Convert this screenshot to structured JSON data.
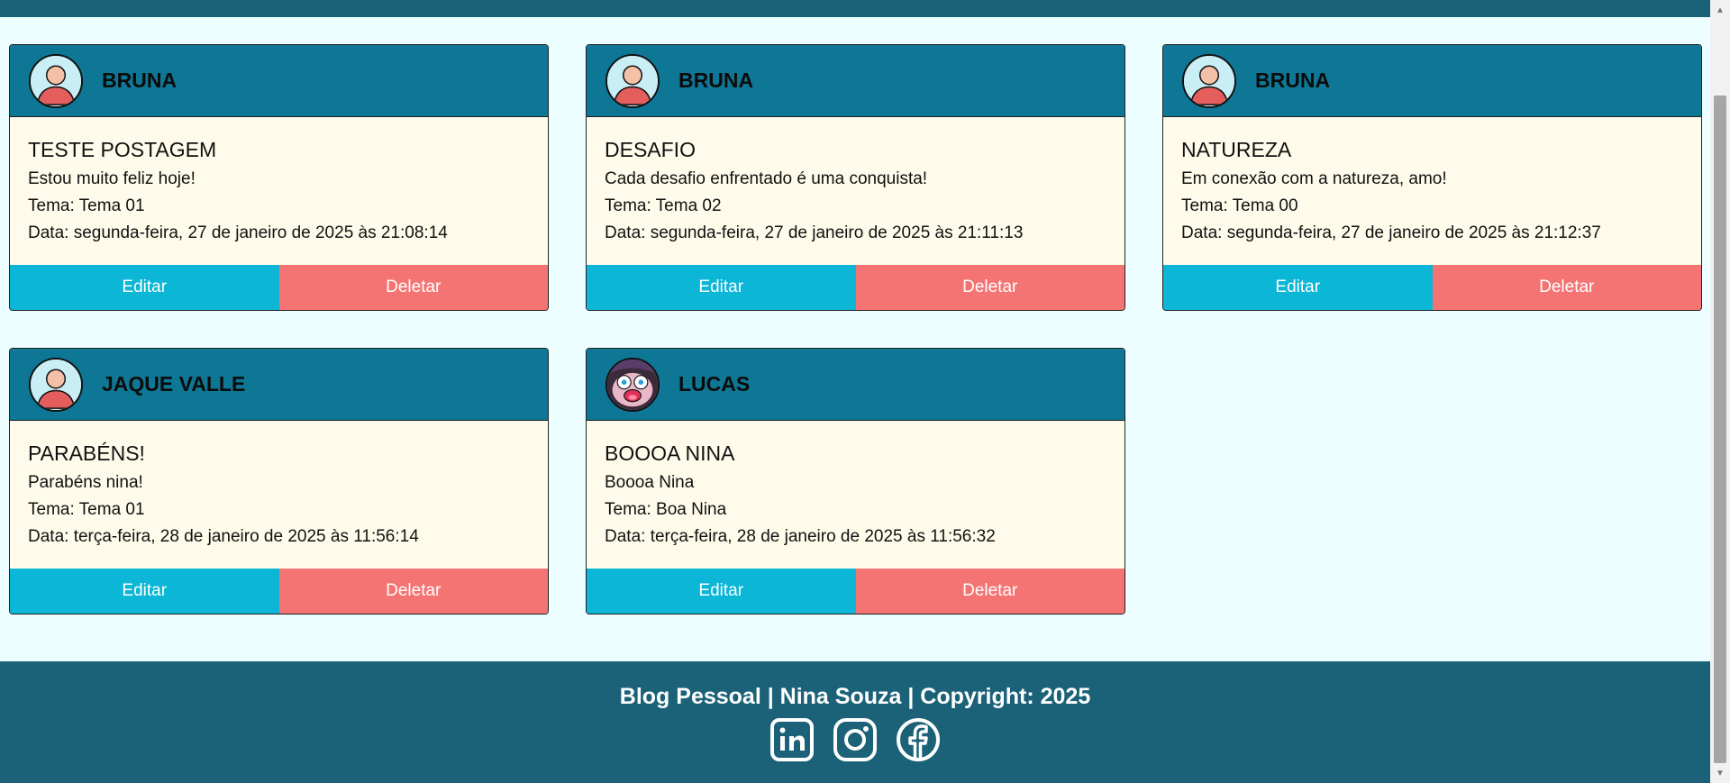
{
  "posts": [
    {
      "author": "BRUNA",
      "avatar": "default-user-avatar",
      "title": "TESTE POSTAGEM",
      "text": "Estou muito feliz hoje!",
      "theme": "Tema: Tema 01",
      "date": "Data: segunda-feira, 27 de janeiro de 2025 às 21:08:14",
      "edit_label": "Editar",
      "delete_label": "Deletar"
    },
    {
      "author": "BRUNA",
      "avatar": "default-user-avatar",
      "title": "DESAFIO",
      "text": "Cada desafio enfrentado é uma conquista!",
      "theme": "Tema: Tema 02",
      "date": "Data: segunda-feira, 27 de janeiro de 2025 às 21:11:13",
      "edit_label": "Editar",
      "delete_label": "Deletar"
    },
    {
      "author": "BRUNA",
      "avatar": "default-user-avatar",
      "title": "NATUREZA",
      "text": "Em conexão com a natureza, amo!",
      "theme": "Tema: Tema 00",
      "date": "Data: segunda-feira, 27 de janeiro de 2025 às 21:12:37",
      "edit_label": "Editar",
      "delete_label": "Deletar"
    },
    {
      "author": "JAQUE VALLE",
      "avatar": "default-user-avatar",
      "title": "PARABÉNS!",
      "text": "Parabéns nina!",
      "theme": "Tema: Tema 01",
      "date": "Data: terça-feira, 28 de janeiro de 2025 às 11:56:14",
      "edit_label": "Editar",
      "delete_label": "Deletar"
    },
    {
      "author": "LUCAS",
      "avatar": "cartoon-character-avatar",
      "title": "BOOOA NINA",
      "text": "Boooa Nina",
      "theme": "Tema: Boa Nina",
      "date": "Data: terça-feira, 28 de janeiro de 2025 às 11:56:32",
      "edit_label": "Editar",
      "delete_label": "Deletar"
    }
  ],
  "footer": {
    "text": "Blog Pessoal | Nina Souza | Copyright: 2025",
    "social_icons": [
      "linkedin-icon",
      "instagram-icon",
      "facebook-icon"
    ]
  },
  "colors": {
    "page_bg": "#ecfeff",
    "header_bar": "#1b6278",
    "card_header": "#0e7795",
    "card_body": "#fefbea",
    "edit_button": "#0bb6d6",
    "delete_button": "#f47373"
  }
}
